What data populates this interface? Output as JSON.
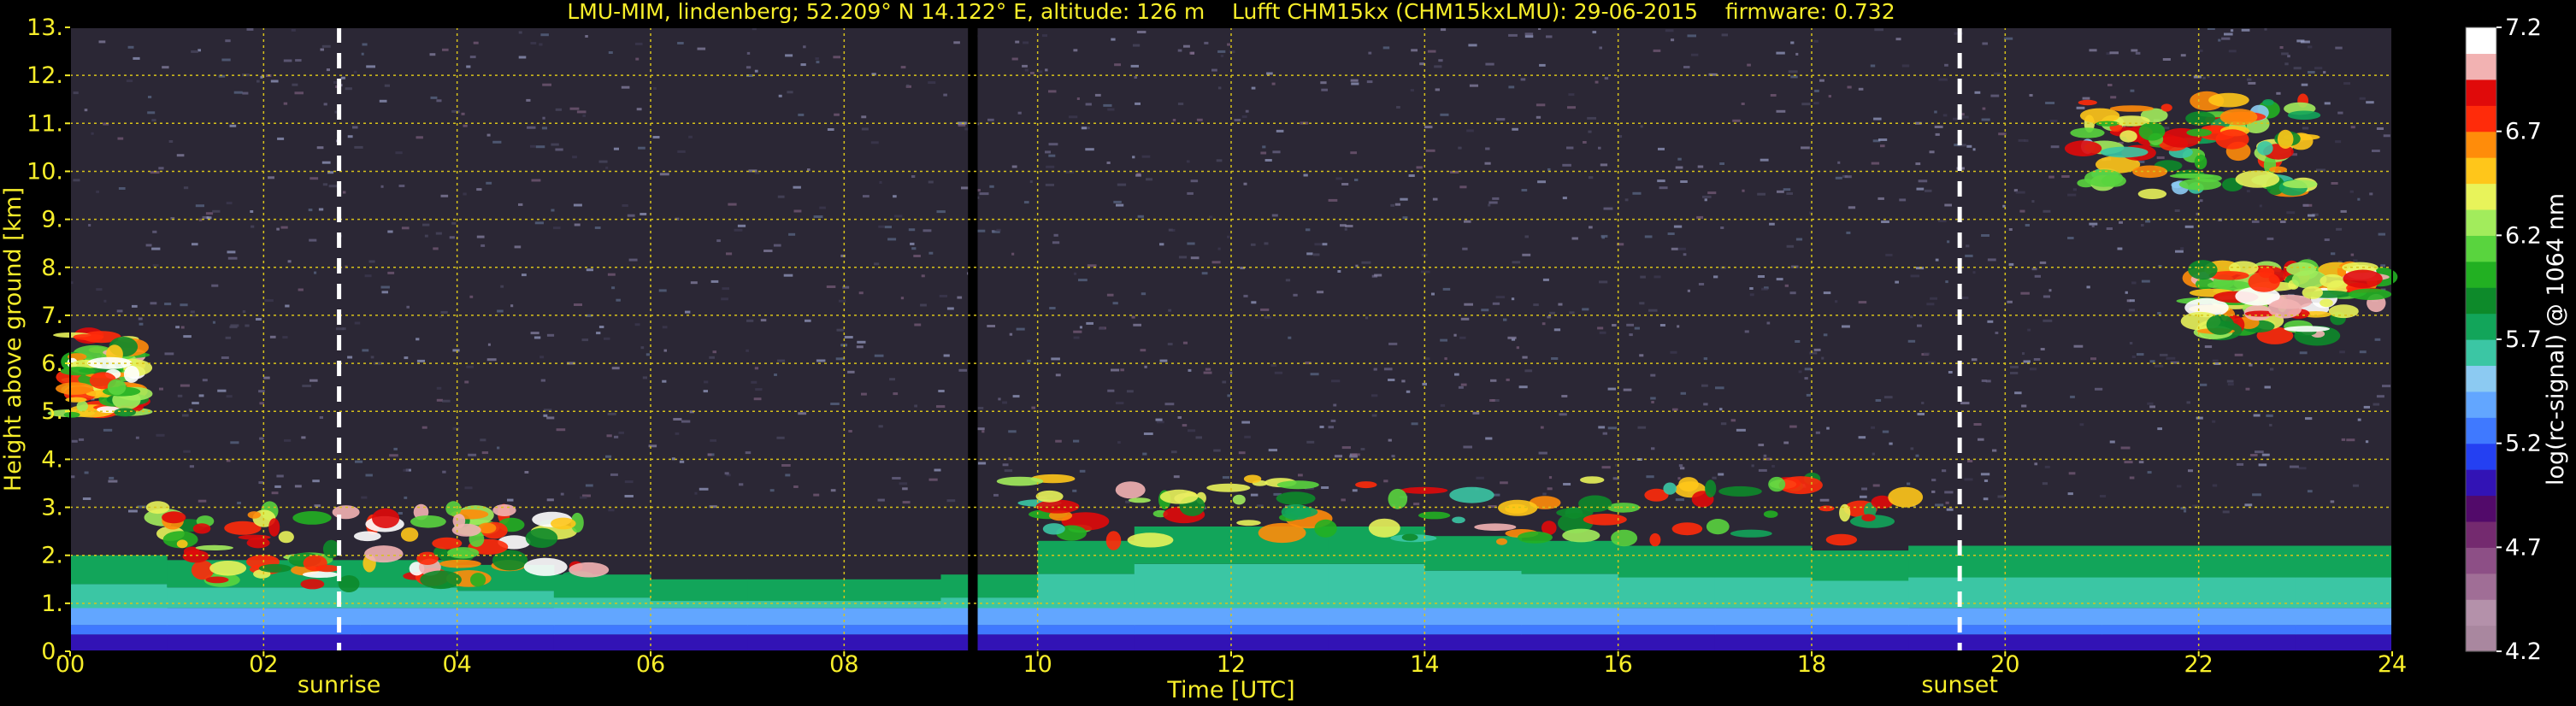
{
  "chart_data": {
    "type": "heatmap",
    "title": "LMU-MIM, lindenberg; 52.209° N 14.122° E, altitude: 126 m    Lufft CHM15kx (CHM15kxLMU): 29-06-2015    firmware: 0.732",
    "xlabel": "Time [UTC]",
    "ylabel": "Height above ground [km]",
    "xlim": [
      0,
      24
    ],
    "ylim": [
      0,
      13
    ],
    "x_ticks": [
      0,
      2,
      4,
      6,
      8,
      10,
      12,
      14,
      16,
      18,
      20,
      22,
      24
    ],
    "x_tick_labels": [
      "00",
      "02",
      "04",
      "06",
      "08",
      "10",
      "12",
      "14",
      "16",
      "18",
      "20",
      "22",
      "24"
    ],
    "y_ticks": [
      0,
      1,
      2,
      3,
      4,
      5,
      6,
      7,
      8,
      9,
      10,
      11,
      12,
      13
    ],
    "y_tick_labels": [
      "0.",
      "1.",
      "2.",
      "3.",
      "4.",
      "5.",
      "6.",
      "7.",
      "8.",
      "9.",
      "10.",
      "11.",
      "12.",
      "13."
    ],
    "grid": true,
    "grid_color": "#d8c31a",
    "colorbar": {
      "label": "log(rc-signal) @ 1064 nm",
      "range": [
        4.2,
        7.2
      ],
      "ticks": [
        4.2,
        4.7,
        5.2,
        5.7,
        6.2,
        6.7,
        7.2
      ],
      "tick_labels": [
        "4.2",
        "4.7",
        "5.2",
        "5.7",
        "6.2",
        "6.7",
        "7.2"
      ],
      "colors": [
        "#a9879f",
        "#b491aa",
        "#a06e96",
        "#8d4f86",
        "#742a6f",
        "#520a6a",
        "#3213b5",
        "#2440f2",
        "#3f79ff",
        "#62a6ff",
        "#8ccaf2",
        "#3bc6a4",
        "#12a55a",
        "#0d8a2a",
        "#22b022",
        "#59d43e",
        "#a2ec5c",
        "#e8f35a",
        "#ffc61a",
        "#ff8c0a",
        "#ff2b0a",
        "#e00a0a",
        "#f2b2b2",
        "#ffffff"
      ]
    },
    "markers": [
      {
        "label": "sunrise",
        "x": 2.78
      },
      {
        "label": "sunset",
        "x": 19.53
      }
    ],
    "data_gap": {
      "x": [
        9.28,
        9.38
      ]
    },
    "features": [
      {
        "name": "boundary layer aerosol",
        "x": [
          0,
          24
        ],
        "y_top_km": [
          2.0,
          1.9,
          1.9,
          1.9,
          1.8,
          1.6,
          1.5,
          1.5,
          1.5,
          1.6,
          2.3,
          2.6,
          2.6,
          2.6,
          2.4,
          2.3,
          2.2,
          2.2,
          2.1,
          2.2,
          2.2,
          2.2,
          2.2,
          2.2
        ]
      },
      {
        "name": "low cloud / residual layer",
        "x_range": [
          0.9,
          5.4
        ],
        "y_range_km": [
          0.3,
          3.0
        ],
        "max_log_signal": 7.2
      },
      {
        "name": "elevated cloud early",
        "x_range": [
          0.0,
          0.7
        ],
        "y_range_km": [
          3.8,
          6.6
        ],
        "max_log_signal": 7.2
      },
      {
        "name": "cloud tops",
        "x_range": [
          9.8,
          19.0
        ],
        "y_range_km": [
          1.4,
          3.6
        ],
        "max_log_signal": 7.0
      },
      {
        "name": "cirrus",
        "x_range": [
          20.8,
          23.1
        ],
        "y_range_km": [
          8.2,
          11.5
        ],
        "max_log_signal": 6.9
      },
      {
        "name": "mid-level cloud evening",
        "x_range": [
          22.0,
          23.9
        ],
        "y_range_km": [
          5.6,
          8.0
        ],
        "max_log_signal": 7.2
      }
    ]
  }
}
